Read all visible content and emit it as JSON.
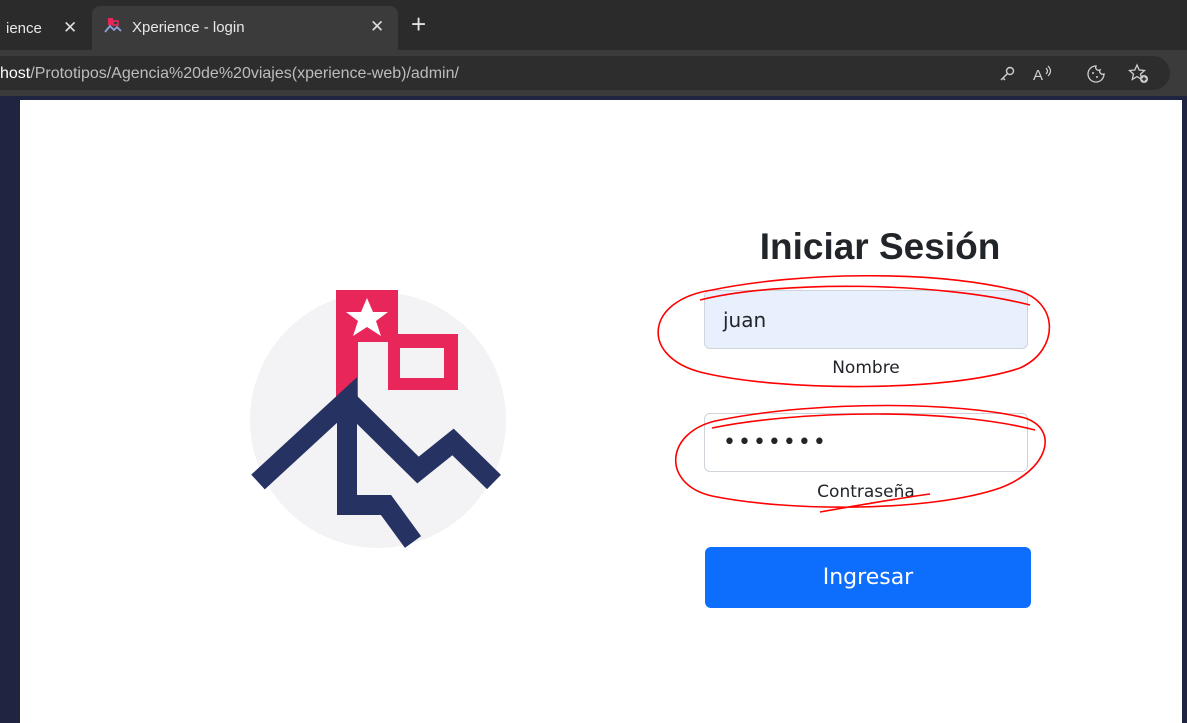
{
  "browser": {
    "tabs": [
      {
        "label": "ience",
        "active": false
      },
      {
        "label": "Xperience - login",
        "active": true
      }
    ],
    "close_glyph": "✕",
    "new_tab_glyph": "+",
    "url_host": "host",
    "url_path": "/Prototipos/Agencia%20de%20viajes(xperience-web)/admin/",
    "address_icons": [
      "key-icon",
      "read-aloud-icon",
      "cookie-icon",
      "favorites-add-icon"
    ]
  },
  "login": {
    "title": "Iniciar Sesión",
    "username_value": "juan",
    "username_label": "Nombre",
    "password_value": "•••••••",
    "password_label": "Contraseña",
    "submit_label": "Ingresar"
  },
  "colors": {
    "page_bg": "#1f2541",
    "logo_red": "#e8265a",
    "logo_navy": "#253262",
    "primary_button": "#0d6efd",
    "annotation": "#ff0000"
  }
}
